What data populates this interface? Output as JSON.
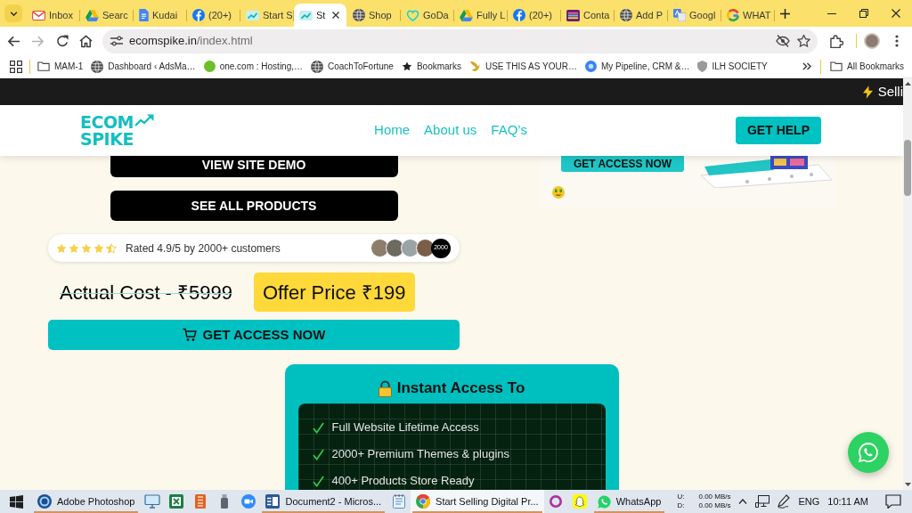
{
  "browser": {
    "tabs": [
      {
        "kind": "envelope",
        "label": "Inbox",
        "selected": false
      },
      {
        "kind": "triangle",
        "label": "Searc",
        "selected": false
      },
      {
        "kind": "document",
        "label": "Kudai",
        "selected": false
      },
      {
        "kind": "round-logo",
        "label": "(20+)",
        "selected": false
      },
      {
        "kind": "spike-logo",
        "label": "Start S",
        "selected": false
      },
      {
        "kind": "spike-logo",
        "label": "St",
        "selected": true
      },
      {
        "kind": "globe",
        "label": "Shop",
        "selected": false
      },
      {
        "kind": "swirl",
        "label": "GoDa",
        "selected": false
      },
      {
        "kind": "triangle",
        "label": "Fully L",
        "selected": false
      },
      {
        "kind": "round-logo",
        "label": "(20+)",
        "selected": false
      },
      {
        "kind": "stripes",
        "label": "Conta",
        "selected": false
      },
      {
        "kind": "globe",
        "label": "Add P",
        "selected": false
      },
      {
        "kind": "bubbles",
        "label": "Googl",
        "selected": false
      },
      {
        "kind": "ring",
        "label": "WHAT",
        "selected": false
      }
    ],
    "nav_buttons": [
      {
        "kind": "back",
        "disabled": false
      },
      {
        "kind": "forward",
        "disabled": true
      },
      {
        "kind": "reload",
        "disabled": false
      },
      {
        "kind": "home",
        "disabled": false
      }
    ],
    "address": {
      "host": "ecomspike.in",
      "path": "/index.html"
    },
    "bookmarks": [
      {
        "kind": "folder",
        "label": "MAM-1"
      },
      {
        "kind": "globe",
        "label": "Dashboard ‹ AdsMa…"
      },
      {
        "kind": "dot",
        "label": "one.com : Hosting,…"
      },
      {
        "kind": "globe",
        "label": "CoachToFortune"
      },
      {
        "kind": "star",
        "label": "Bookmarks"
      },
      {
        "kind": "leaf",
        "label": "USE THIS AS YOUR…"
      },
      {
        "kind": "emblem",
        "label": "My Pipeline, CRM &…"
      },
      {
        "kind": "shield",
        "label": "ILH SOCIETY"
      }
    ],
    "all_bookmarks": "All Bookmarks"
  },
  "page": {
    "announcement": "Selli",
    "logo": [
      "ECOM",
      "SPIKE"
    ],
    "nav": [
      "Home",
      "About us",
      "FAQ’s"
    ],
    "help_button": "GET HELP",
    "buttons": [
      "VIEW SITE DEMO",
      "SEE ALL PRODUCTS"
    ],
    "rating": {
      "stars": 4.5,
      "text": "Rated 4.9/5 by 2000+ customers",
      "count": "2000"
    },
    "actual_cost": {
      "text": "Actual Cost - ₹5999",
      "struck": true
    },
    "offer_price": "Offer Price ₹199",
    "access_button": "GET ACCESS NOW",
    "promo_button": "GET ACCESS NOW",
    "access_card": {
      "title": "Instant Access To",
      "items": [
        "Full Website Lifetime Access",
        "2000+ Premium Themes & plugins",
        "400+ Products Store Ready"
      ]
    }
  },
  "taskbar": {
    "apps": [
      {
        "kind": "photoshop",
        "label": "Adobe Photoshop",
        "running": true,
        "selected": false
      },
      {
        "kind": "monitor",
        "running": false,
        "selected": false
      },
      {
        "kind": "sheet",
        "running": false,
        "selected": false
      },
      {
        "kind": "shelf",
        "running": false,
        "selected": false
      },
      {
        "kind": "usb",
        "running": false,
        "selected": false
      },
      {
        "kind": "video",
        "running": false,
        "selected": false
      },
      {
        "kind": "word",
        "label": "Document2 - Micros...",
        "running": true,
        "selected": false
      },
      {
        "kind": "notepad",
        "running": false,
        "selected": false
      },
      {
        "kind": "chrome",
        "label": "Start Selling Digital Pr...",
        "running": true,
        "selected": true
      },
      {
        "kind": "circle",
        "running": false,
        "selected": false
      },
      {
        "kind": "ghost",
        "running": false,
        "selected": false
      },
      {
        "kind": "chat",
        "label": "WhatsApp",
        "running": true,
        "selected": false
      }
    ],
    "speeds": [
      {
        "label": "U:",
        "value": "0.00 MB/s"
      },
      {
        "label": "D:",
        "value": "0.00 MB/s"
      }
    ],
    "language": "ENG",
    "time": "10:11 AM"
  }
}
